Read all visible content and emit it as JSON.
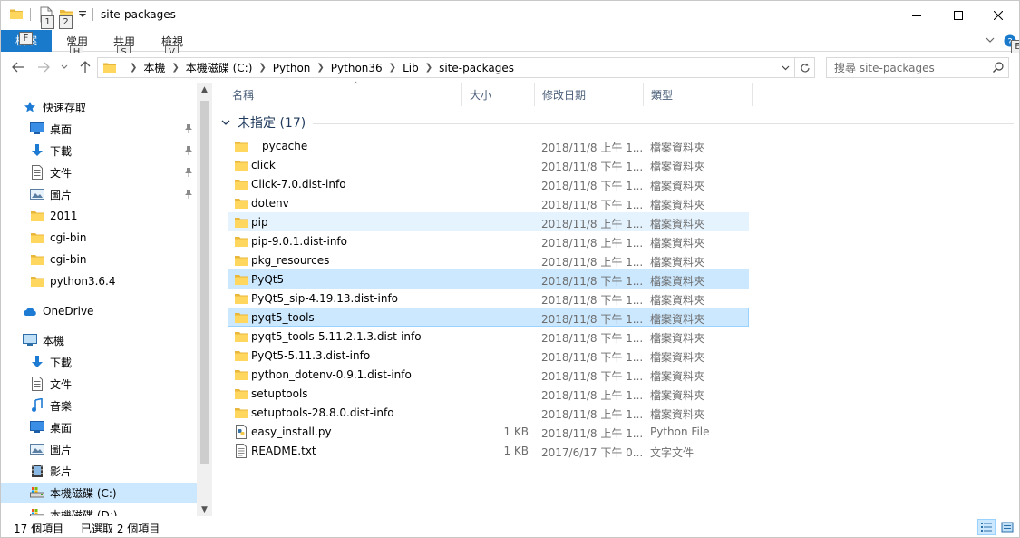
{
  "window": {
    "title": "site-packages",
    "keytips": {
      "qa1": "1",
      "qa2": "2",
      "file": "F",
      "home": "H",
      "share": "S",
      "view": "V",
      "help": "E"
    }
  },
  "ribbon": {
    "file_tab": "檔案",
    "tabs": [
      {
        "label": "常用"
      },
      {
        "label": "共用"
      },
      {
        "label": "檢視"
      }
    ]
  },
  "address": {
    "breadcrumbs": [
      "本機",
      "本機磁碟 (C:)",
      "Python",
      "Python36",
      "Lib",
      "site-packages"
    ]
  },
  "search": {
    "placeholder": "搜尋 site-packages"
  },
  "nav": {
    "quick_access": "快速存取",
    "quick_items": [
      {
        "label": "桌面",
        "icon": "desktop-icon",
        "pinned": true
      },
      {
        "label": "下載",
        "icon": "download-icon",
        "pinned": true
      },
      {
        "label": "文件",
        "icon": "document-icon",
        "pinned": true
      },
      {
        "label": "圖片",
        "icon": "picture-icon",
        "pinned": true
      },
      {
        "label": "2011",
        "icon": "folder-icon",
        "pinned": false
      },
      {
        "label": "cgi-bin",
        "icon": "folder-icon",
        "pinned": false
      },
      {
        "label": "cgi-bin",
        "icon": "folder-icon",
        "pinned": false
      },
      {
        "label": "python3.6.4",
        "icon": "folder-icon",
        "pinned": false
      }
    ],
    "onedrive": "OneDrive",
    "this_pc": "本機",
    "pc_items": [
      {
        "label": "下載",
        "icon": "download-icon"
      },
      {
        "label": "文件",
        "icon": "document-icon"
      },
      {
        "label": "音樂",
        "icon": "music-icon"
      },
      {
        "label": "桌面",
        "icon": "desktop-icon"
      },
      {
        "label": "圖片",
        "icon": "picture-icon"
      },
      {
        "label": "影片",
        "icon": "video-icon"
      },
      {
        "label": "本機磁碟 (C:)",
        "icon": "drive-icon"
      },
      {
        "label": "本機磁碟 (D:)",
        "icon": "drive-icon"
      }
    ]
  },
  "columns": {
    "name": "名稱",
    "size": "大小",
    "date": "修改日期",
    "type": "類型"
  },
  "group": {
    "title": "未指定 (17)"
  },
  "files": [
    {
      "name": "__pycache__",
      "size": "",
      "date": "2018/11/8 上午 1...",
      "type": "檔案資料夾",
      "icon": "folder-icon",
      "state": ""
    },
    {
      "name": "click",
      "size": "",
      "date": "2018/11/8 下午 1...",
      "type": "檔案資料夾",
      "icon": "folder-icon",
      "state": ""
    },
    {
      "name": "Click-7.0.dist-info",
      "size": "",
      "date": "2018/11/8 下午 1...",
      "type": "檔案資料夾",
      "icon": "folder-icon",
      "state": ""
    },
    {
      "name": "dotenv",
      "size": "",
      "date": "2018/11/8 下午 1...",
      "type": "檔案資料夾",
      "icon": "folder-icon",
      "state": ""
    },
    {
      "name": "pip",
      "size": "",
      "date": "2018/11/8 上午 1...",
      "type": "檔案資料夾",
      "icon": "folder-icon",
      "state": "hover"
    },
    {
      "name": "pip-9.0.1.dist-info",
      "size": "",
      "date": "2018/11/8 上午 1...",
      "type": "檔案資料夾",
      "icon": "folder-icon",
      "state": ""
    },
    {
      "name": "pkg_resources",
      "size": "",
      "date": "2018/11/8 上午 1...",
      "type": "檔案資料夾",
      "icon": "folder-icon",
      "state": ""
    },
    {
      "name": "PyQt5",
      "size": "",
      "date": "2018/11/8 下午 1...",
      "type": "檔案資料夾",
      "icon": "folder-icon",
      "state": "selected"
    },
    {
      "name": "PyQt5_sip-4.19.13.dist-info",
      "size": "",
      "date": "2018/11/8 下午 1...",
      "type": "檔案資料夾",
      "icon": "folder-icon",
      "state": ""
    },
    {
      "name": "pyqt5_tools",
      "size": "",
      "date": "2018/11/8 下午 1...",
      "type": "檔案資料夾",
      "icon": "folder-icon",
      "state": "selected-focused"
    },
    {
      "name": "pyqt5_tools-5.11.2.1.3.dist-info",
      "size": "",
      "date": "2018/11/8 下午 1...",
      "type": "檔案資料夾",
      "icon": "folder-icon",
      "state": ""
    },
    {
      "name": "PyQt5-5.11.3.dist-info",
      "size": "",
      "date": "2018/11/8 下午 1...",
      "type": "檔案資料夾",
      "icon": "folder-icon",
      "state": ""
    },
    {
      "name": "python_dotenv-0.9.1.dist-info",
      "size": "",
      "date": "2018/11/8 下午 1...",
      "type": "檔案資料夾",
      "icon": "folder-icon",
      "state": ""
    },
    {
      "name": "setuptools",
      "size": "",
      "date": "2018/11/8 上午 1...",
      "type": "檔案資料夾",
      "icon": "folder-icon",
      "state": ""
    },
    {
      "name": "setuptools-28.8.0.dist-info",
      "size": "",
      "date": "2018/11/8 上午 1...",
      "type": "檔案資料夾",
      "icon": "folder-icon",
      "state": ""
    },
    {
      "name": "easy_install.py",
      "size": "1 KB",
      "date": "2018/11/8 上午 1...",
      "type": "Python File",
      "icon": "python-file-icon",
      "state": ""
    },
    {
      "name": "README.txt",
      "size": "1 KB",
      "date": "2017/6/17 下午 0...",
      "type": "文字文件",
      "icon": "text-file-icon",
      "state": ""
    }
  ],
  "status": {
    "count": "17 個項目",
    "selected": "已選取 2 個項目"
  },
  "colors": {
    "accent": "#1979ca",
    "selection": "#cce8ff",
    "hover": "#e5f3ff",
    "folder": "#ffd75e",
    "folder_dark": "#e8b73b"
  }
}
